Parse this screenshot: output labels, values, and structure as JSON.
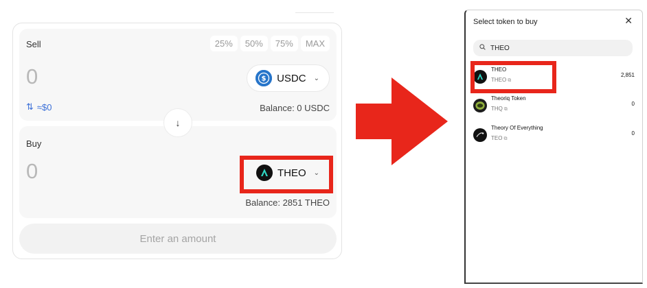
{
  "swap": {
    "sell": {
      "label": "Sell",
      "percent_buttons": [
        "25%",
        "50%",
        "75%",
        "MAX"
      ],
      "amount": "0",
      "token": "USDC",
      "usd_value": "≈$0",
      "balance": "Balance: 0 USDC"
    },
    "buy": {
      "label": "Buy",
      "amount": "0",
      "token": "THEO",
      "balance": "Balance: 2851 THEO"
    },
    "submit_label": "Enter an amount"
  },
  "modal": {
    "title": "Select token to buy",
    "search_value": "THEO",
    "tokens": [
      {
        "name": "THEO",
        "symbol": "THEO",
        "balance": "2,851"
      },
      {
        "name": "Theoriq Token",
        "symbol": "THQ",
        "balance": "0"
      },
      {
        "name": "Theory Of Everything",
        "symbol": "TEO",
        "balance": "0"
      }
    ]
  },
  "colors": {
    "highlight": "#e8261b",
    "usdc_blue": "#2775ca",
    "link_blue": "#3b6fd8"
  }
}
